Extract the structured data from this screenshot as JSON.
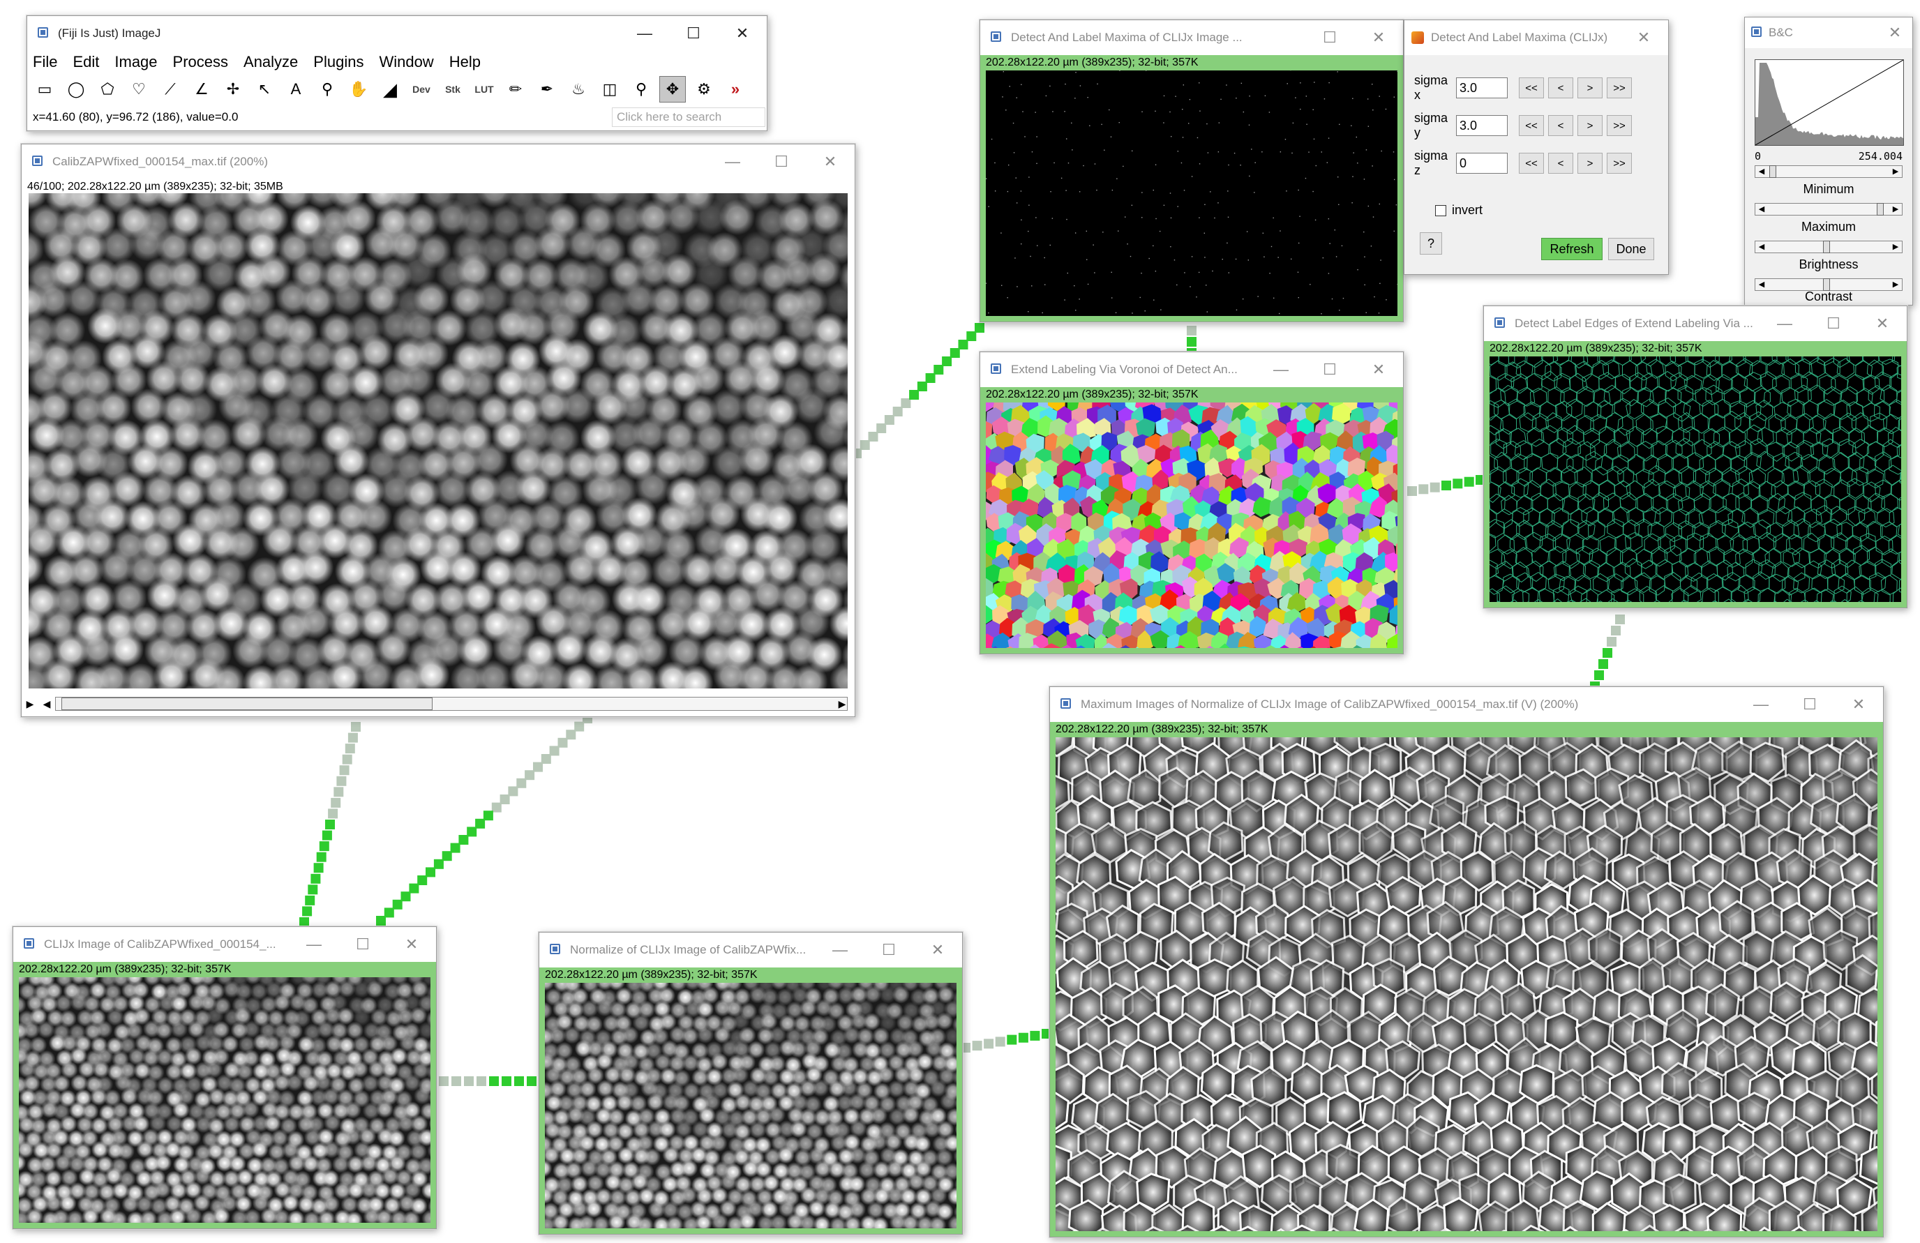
{
  "imagej": {
    "title": "(Fiji Is Just) ImageJ",
    "menu": [
      "File",
      "Edit",
      "Image",
      "Process",
      "Analyze",
      "Plugins",
      "Window",
      "Help"
    ],
    "tool_labels": {
      "dev": "Dev",
      "stk": "Stk",
      "lut": "LUT"
    },
    "status": "x=41.60 (80), y=96.72 (186), value=0.0",
    "search_placeholder": "Click here to search"
  },
  "win_original": {
    "title": "CalibZAPWfixed_000154_max.tif (200%)",
    "info": "46/100; 202.28x122.20 µm (389x235); 32-bit; 35MB"
  },
  "win_maxima": {
    "title": "Detect And Label Maxima of CLIJx Image ...",
    "info": "202.28x122.20 µm (389x235); 32-bit; 357K"
  },
  "dlg_maxima": {
    "title": "Detect And Label Maxima (CLIJx)",
    "rows": [
      {
        "label": "sigma x",
        "value": "3.0"
      },
      {
        "label": "sigma y",
        "value": "3.0"
      },
      {
        "label": "sigma z",
        "value": "0"
      }
    ],
    "step_buttons": [
      "<<",
      "<",
      ">",
      ">>"
    ],
    "invert_label": "invert",
    "help_label": "?",
    "refresh_label": "Refresh",
    "done_label": "Done"
  },
  "bc": {
    "title": "B&C",
    "min_value": "0",
    "max_value": "254.004",
    "labels": [
      "Minimum",
      "Maximum",
      "Brightness",
      "Contrast"
    ]
  },
  "win_voronoi": {
    "title": "Extend Labeling Via Voronoi of Detect An...",
    "info": "202.28x122.20 µm (389x235); 32-bit; 357K"
  },
  "win_edges": {
    "title": "Detect Label Edges of Extend Labeling Via ...",
    "info": "202.28x122.20 µm (389x235); 32-bit; 357K"
  },
  "win_maximum": {
    "title": "Maximum Images of Normalize of CLIJx Image of CalibZAPWfixed_000154_max.tif (V) (200%)",
    "info": "202.28x122.20 µm (389x235); 32-bit; 357K"
  },
  "win_clijx": {
    "title": "CLIJx Image of CalibZAPWfixed_000154_...",
    "info": "202.28x122.20 µm (389x235); 32-bit; 357K"
  },
  "win_normalize": {
    "title": "Normalize of CLIJx Image of CalibZAPWfix...",
    "info": "202.28x122.20 µm (389x235); 32-bit; 357K"
  },
  "colors": {
    "accent_green": "#87cf7b",
    "connector_green": "#2ecc2e",
    "connector_gray": "#b8c8b8",
    "refresh_green": "#6fcf5f",
    "edge_teal": "#2fae7f"
  }
}
